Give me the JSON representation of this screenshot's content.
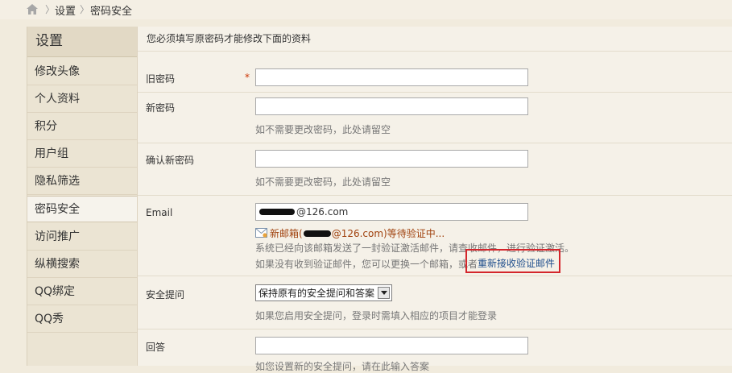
{
  "breadcrumb": {
    "items": [
      "设置",
      "密码安全"
    ]
  },
  "sidebar": {
    "title": "设置",
    "items": [
      {
        "label": "修改头像",
        "active": false
      },
      {
        "label": "个人资料",
        "active": false
      },
      {
        "label": "积分",
        "active": false
      },
      {
        "label": "用户组",
        "active": false
      },
      {
        "label": "隐私筛选",
        "active": false
      },
      {
        "label": "密码安全",
        "active": true
      },
      {
        "label": "访问推广",
        "active": false
      },
      {
        "label": "纵横搜索",
        "active": false
      },
      {
        "label": "QQ绑定",
        "active": false
      },
      {
        "label": "QQ秀",
        "active": false
      }
    ]
  },
  "form": {
    "notice": "您必须填写原密码才能修改下面的资料",
    "old_password": {
      "label": "旧密码",
      "required_mark": "*",
      "value": ""
    },
    "new_password": {
      "label": "新密码",
      "value": "",
      "hint": "如不需要更改密码，此处请留空"
    },
    "confirm_password": {
      "label": "确认新密码",
      "value": "",
      "hint": "如不需要更改密码，此处请留空"
    },
    "email": {
      "label": "Email",
      "value_suffix": "@126.com",
      "pending_prefix": "新邮箱(",
      "pending_suffix": "@126.com)等待验证中...",
      "sent_note": "系统已经向该邮箱发送了一封验证激活邮件，请查收邮件，进行验证激活。",
      "change_note": "如果没有收到验证邮件，您可以更换一个邮箱，或者",
      "resend_link": "重新接收验证邮件"
    },
    "security_question": {
      "label": "安全提问",
      "selected": "保持原有的安全提问和答案",
      "hint": "如果您启用安全提问，登录时需填入相应的项目才能登录"
    },
    "answer": {
      "label": "回答",
      "value": "",
      "hint": "如您设置新的安全提问，请在此输入答案"
    }
  },
  "colors": {
    "required": "#cc3300",
    "pending": "#a0410d",
    "link": "#1f4e8c",
    "highlight_box": "#d4262c"
  },
  "icons": {
    "home": "home-icon",
    "mail": "mail-icon",
    "dropdown": "chevron-down-icon"
  }
}
